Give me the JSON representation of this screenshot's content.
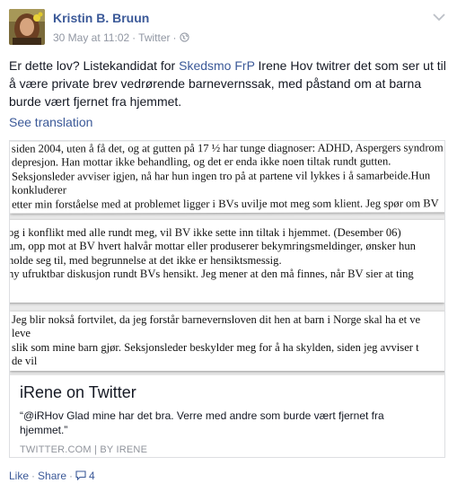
{
  "post": {
    "author": "Kristin B. Bruun",
    "timestamp": "30 May at 11:02",
    "source": "Twitter",
    "text_before_link": "Er dette lov? Listekandidat for ",
    "link_text": "Skedsmo FrP",
    "text_after_link": " Irene Hov twitrer det som ser ut til å være private brev vedrørende barnevernssak, med påstand om at barna burde vært fjernet fra hjemmet.",
    "see_translation": "See translation"
  },
  "scan": {
    "strip1": [
      "siden 2004, uten å få det, og at gutten på 17 ½ har tunge diagnoser: ADHD, Aspergers syndrom",
      "depresjon. Han mottar ikke behandling, og det er enda ikke noen tiltak rundt gutten.",
      "Seksjonsleder avviser igjen, nå har hun ingen tro på at partene vil lykkes i å samarbeide.Hun",
      "konkluderer",
      "etter min forståelse med at problemet ligger i BVs uvilje mot meg som klient. Jeg spør om BV"
    ],
    "strip2": [
      "og i konflikt med alle rundt meg, vil BV ikke sette inn tiltak i hjemmet. (Desember 06)",
      "um, opp mot at BV hvert halvår mottar eller produserer bekymringsmeldinger, ønsker hun",
      "holde seg til, med begrunnelse at det ikke er hensiktsmessig.",
      "ny ufruktbar diskusjon rundt BVs hensikt. Jeg mener at den må finnes, når BV sier at ting"
    ],
    "strip3": [
      "Jeg blir nokså fortvilet, da jeg forstår barnevernsloven dit hen at barn i Norge skal ha et ve",
      "leve",
      "slik som mine barn gjør. Seksjonsleder beskylder meg for å ha skylden, siden jeg avviser t",
      "de vil"
    ]
  },
  "card": {
    "title": "iRene on Twitter",
    "description": "“@iRHov Glad mine har det bra. Verre med andre som burde vært fjernet fra hjemmet.”",
    "source": "TWITTER.COM | BY IRENE"
  },
  "actions": {
    "like": "Like",
    "share": "Share",
    "comment_count": "4"
  },
  "colors": {
    "link": "#3b5998",
    "meta": "#9197a3",
    "text": "#141823"
  },
  "icons": {
    "meta_icon": "globe-icon",
    "menu_icon": "chevron-down-icon",
    "comment_icon": "speech-bubble-icon"
  }
}
